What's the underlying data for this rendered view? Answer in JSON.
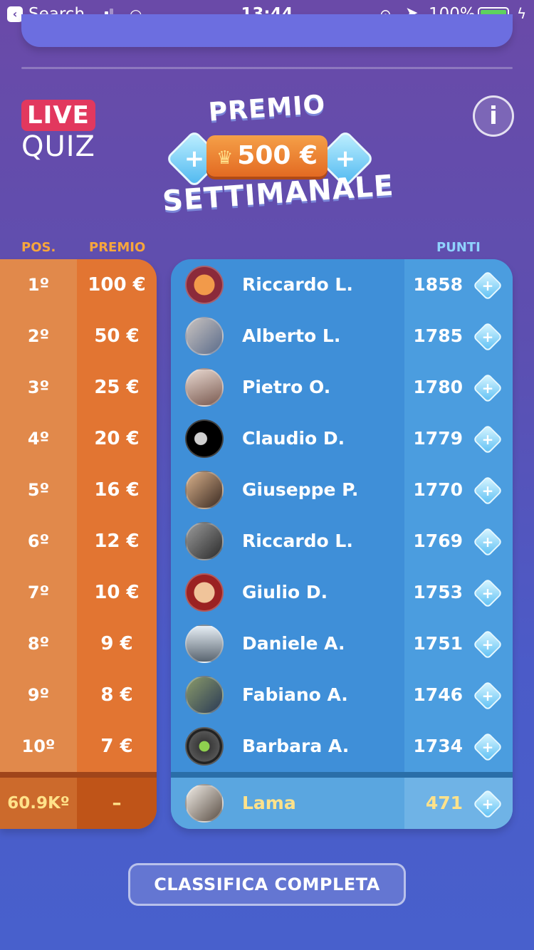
{
  "status_bar": {
    "back_app": "Search",
    "time": "13:44",
    "battery": "100%"
  },
  "logo": {
    "live": "LIVE",
    "quiz": "QUIZ"
  },
  "banner": {
    "line1": "PREMIO",
    "amount": "500 €",
    "line2": "SETTIMANALE"
  },
  "headers": {
    "pos": "POS.",
    "premio": "PREMIO",
    "punti": "PUNTI"
  },
  "prizes": [
    {
      "pos": "1º",
      "prize": "100 €"
    },
    {
      "pos": "2º",
      "prize": "50 €"
    },
    {
      "pos": "3º",
      "prize": "25 €"
    },
    {
      "pos": "4º",
      "prize": "20 €"
    },
    {
      "pos": "5º",
      "prize": "16 €"
    },
    {
      "pos": "6º",
      "prize": "12 €"
    },
    {
      "pos": "7º",
      "prize": "10 €"
    },
    {
      "pos": "8º",
      "prize": "9 €"
    },
    {
      "pos": "9º",
      "prize": "8 €"
    },
    {
      "pos": "10º",
      "prize": "7 €"
    }
  ],
  "leaderboard": [
    {
      "name": "Riccardo L.",
      "score": "1858"
    },
    {
      "name": "Alberto L.",
      "score": "1785"
    },
    {
      "name": "Pietro O.",
      "score": "1780"
    },
    {
      "name": "Claudio D.",
      "score": "1779"
    },
    {
      "name": "Giuseppe P.",
      "score": "1770"
    },
    {
      "name": "Riccardo L.",
      "score": "1769"
    },
    {
      "name": "Giulio D.",
      "score": "1753"
    },
    {
      "name": "Daniele A.",
      "score": "1751"
    },
    {
      "name": "Fabiano A.",
      "score": "1746"
    },
    {
      "name": "Barbara A.",
      "score": "1734"
    }
  ],
  "me": {
    "pos": "60.9Kº",
    "prize": "–",
    "name": "Lama",
    "score": "471"
  },
  "full_button": "CLASSIFICA COMPLETA",
  "colors": {
    "accent_orange": "#e27532",
    "panel_blue": "#3f8fd8",
    "highlight_yellow": "#ffe28a"
  }
}
